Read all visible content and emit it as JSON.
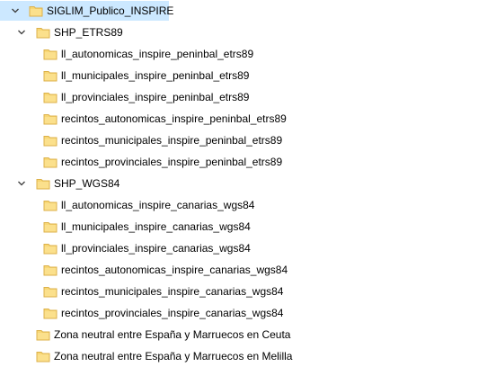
{
  "colors": {
    "folder_body": "#f8d775",
    "folder_edge": "#dcb14a",
    "selection": "#cce8ff",
    "chevron": "#3c3c3c"
  },
  "tree": {
    "root": {
      "label": "SIGLIM_Publico_INSPIRE",
      "icon": "folder-icon",
      "expanded": true
    },
    "etrs": {
      "label": "SHP_ETRS89",
      "icon": "folder-icon",
      "expanded": true,
      "children": [
        "ll_autonomicas_inspire_peninbal_etrs89",
        "ll_municipales_inspire_peninbal_etrs89",
        "ll_provinciales_inspire_peninbal_etrs89",
        "recintos_autonomicas_inspire_peninbal_etrs89",
        "recintos_municipales_inspire_peninbal_etrs89",
        "recintos_provinciales_inspire_peninbal_etrs89"
      ]
    },
    "wgs": {
      "label": "SHP_WGS84",
      "icon": "folder-icon",
      "expanded": true,
      "children": [
        "ll_autonomicas_inspire_canarias_wgs84",
        "ll_municipales_inspire_canarias_wgs84",
        "ll_provinciales_inspire_canarias_wgs84",
        "recintos_autonomicas_inspire_canarias_wgs84",
        "recintos_municipales_inspire_canarias_wgs84",
        "recintos_provinciales_inspire_canarias_wgs84"
      ]
    },
    "ceuta": {
      "label": "Zona neutral entre España y Marruecos en Ceuta",
      "icon": "folder-icon"
    },
    "melilla": {
      "label": "Zona neutral entre España y Marruecos en Melilla",
      "icon": "folder-icon"
    }
  }
}
